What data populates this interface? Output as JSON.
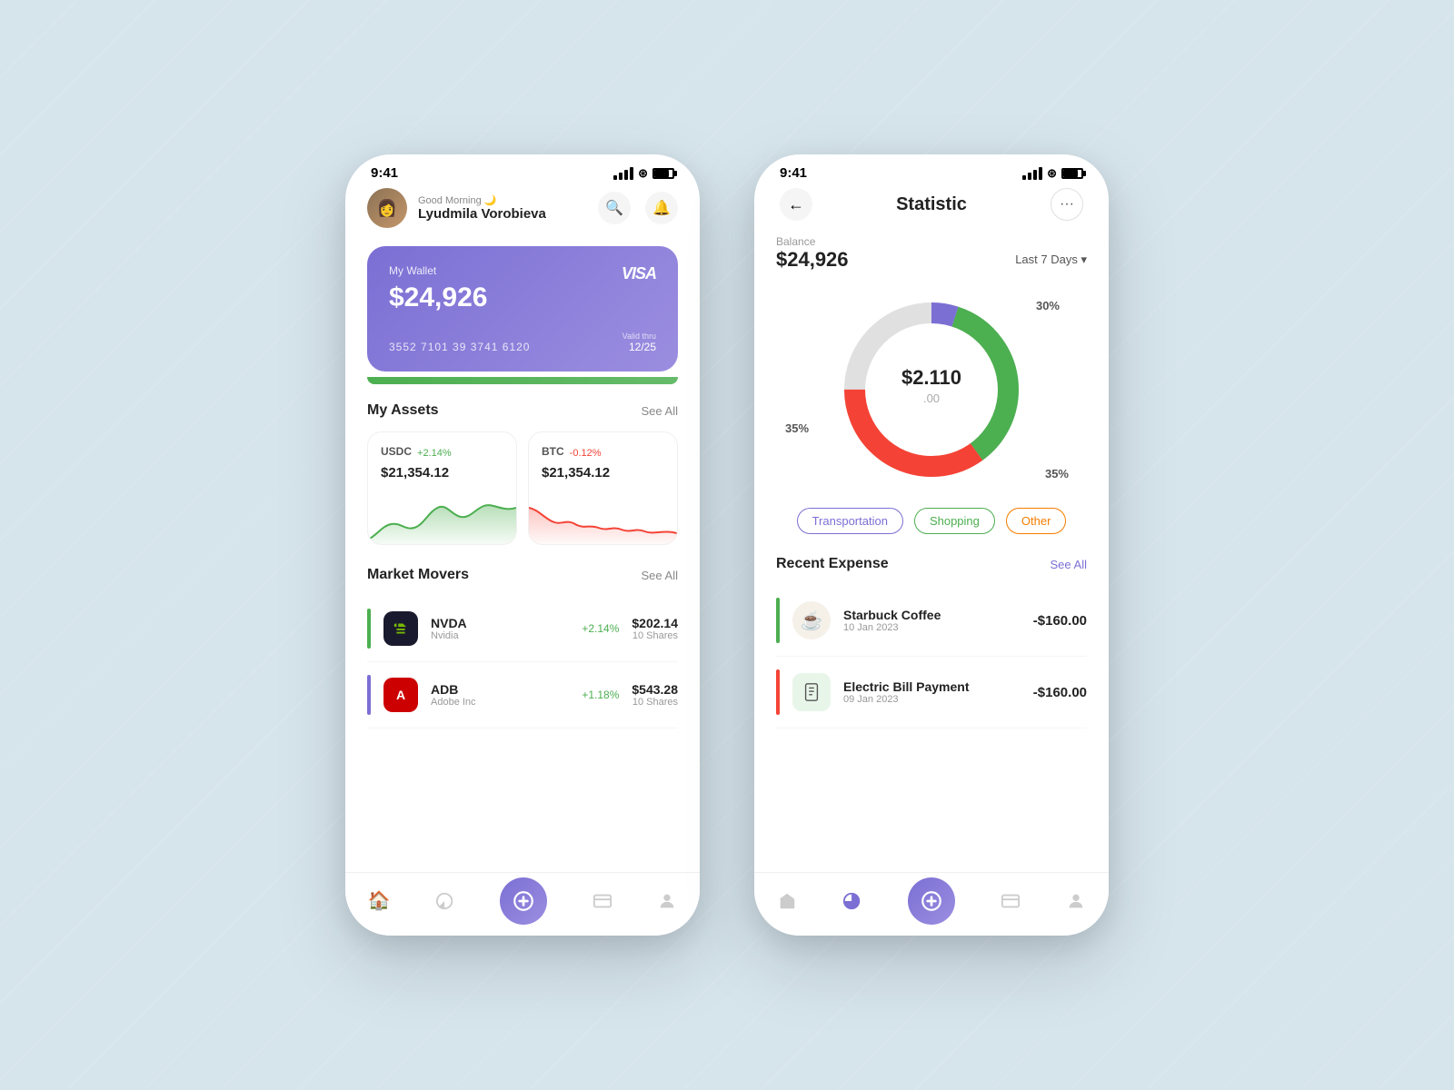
{
  "background": "#d6e4ec",
  "phone_left": {
    "status": {
      "time": "9:41"
    },
    "header": {
      "greeting": "Good Morning 🌙",
      "name": "Lyudmila Vorobieva"
    },
    "card": {
      "label": "My Wallet",
      "balance": "$24,926",
      "number": "3552 7101 39 3741 6120",
      "valid_thru_label": "Valid thru",
      "valid_thru": "12/25",
      "brand": "VISA"
    },
    "assets": {
      "title": "My Assets",
      "see_all": "See All",
      "items": [
        {
          "ticker": "USDC",
          "change": "+2.14%",
          "direction": "up",
          "price": "$21,354.12"
        },
        {
          "ticker": "BTC",
          "change": "-0.12%",
          "direction": "down",
          "price": "$21,354.12"
        }
      ]
    },
    "market_movers": {
      "title": "Market Movers",
      "see_all": "See All",
      "items": [
        {
          "ticker": "NVDA",
          "name": "Nvidia",
          "change": "+2.14%",
          "price": "$202.14",
          "shares": "10 Shares",
          "bar_color": "green"
        },
        {
          "ticker": "ADB",
          "name": "Adobe Inc",
          "change": "+1.18%",
          "price": "$543.28",
          "shares": "10 Shares",
          "bar_color": "purple"
        }
      ]
    },
    "nav": {
      "items": [
        "🏠",
        "📊",
        "⊕",
        "💳",
        "👤"
      ]
    }
  },
  "phone_right": {
    "status": {
      "time": "9:41"
    },
    "header": {
      "title": "Statistic"
    },
    "balance": {
      "label": "Balance",
      "amount": "$24,926",
      "period": "Last 7 Days"
    },
    "chart": {
      "center_amount": "$2.110",
      "center_cents": ".00",
      "segments": [
        {
          "label": "Transportation",
          "percent": 30,
          "color": "#7b6fd4"
        },
        {
          "label": "Shopping",
          "percent": 35,
          "color": "#4caf50"
        },
        {
          "label": "Other",
          "percent": 35,
          "color": "#f44336"
        }
      ],
      "pct_top": "30%",
      "pct_left": "35%",
      "pct_right": "35%"
    },
    "categories": [
      {
        "label": "Transportation",
        "style": "blue"
      },
      {
        "label": "Shopping",
        "style": "green"
      },
      {
        "label": "Other",
        "style": "orange"
      }
    ],
    "recent_expense": {
      "title": "Recent Expense",
      "see_all": "See All",
      "items": [
        {
          "name": "Starbuck Coffee",
          "date": "10 Jan 2023",
          "amount": "-$160.00",
          "icon": "☕",
          "bar_color": "green"
        },
        {
          "name": "Electric Bill Payment",
          "date": "09 Jan 2023",
          "amount": "-$160.00",
          "icon": "💡",
          "bar_color": "red"
        }
      ]
    },
    "nav": {
      "items": [
        "🏠",
        "📊",
        "⊕",
        "💳",
        "👤"
      ]
    }
  }
}
